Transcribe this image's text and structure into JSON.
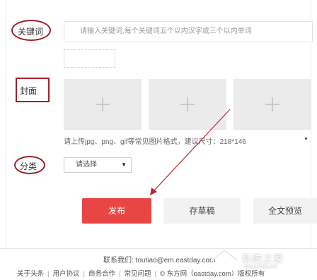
{
  "form": {
    "keywords_label": "关键词",
    "keywords_placeholder": "请输入关键词,每个关键词五个以内汉字或三个以内单词",
    "cover_label": "封面",
    "cover_hint": "请上传jpg、png、gif等常见图片格式，建议尺寸：218*146",
    "category_label": "分类",
    "category_selected": "请选择"
  },
  "actions": {
    "publish": "发布",
    "save_draft": "存草稿",
    "preview": "全文预览"
  },
  "footer": {
    "contact": "联系我们: toutiao@em.eastday.com",
    "links": [
      "关于头条",
      "用户协议",
      "商务合作",
      "常见问题",
      "© 东方网（eastday.com）版权所有"
    ]
  },
  "watermark": {
    "text": "系统之家",
    "url": "xitongzhijia.net"
  },
  "annotation_color": "#a31f2a",
  "accent_color": "#e94544"
}
